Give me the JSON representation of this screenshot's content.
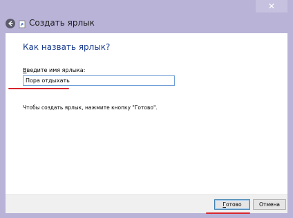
{
  "window": {
    "title": "Создать ярлык",
    "close_label": "✕"
  },
  "page": {
    "heading": "Как назвать ярлык?",
    "field_label_first": "В",
    "field_label_rest": "ведите имя ярлыка:",
    "name_value": "Пора отдыхать",
    "hint": "Чтобы создать ярлык, нажмите кнопку \"Готово\"."
  },
  "buttons": {
    "done_first": "Г",
    "done_rest": "отово",
    "cancel": "Отмена"
  },
  "colors": {
    "frame": "#b9b3d8",
    "heading": "#1b3d8f",
    "annotation": "#d8242c"
  },
  "icons": {
    "back": "back-arrow-icon",
    "shortcut": "shortcut-icon",
    "close": "close-icon"
  }
}
